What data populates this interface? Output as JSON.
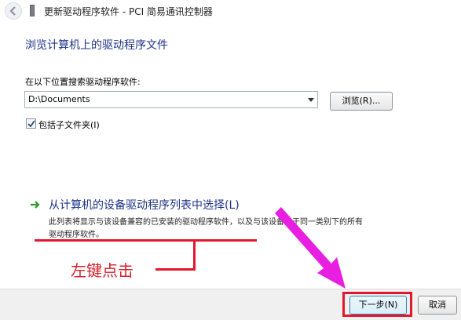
{
  "window": {
    "title": "更新驱动程序软件 - PCI 简易通讯控制器"
  },
  "page": {
    "heading": "浏览计算机上的驱动程序文件",
    "search_label": "在以下位置搜索驱动程序软件:",
    "path_value": "D:\\Documents",
    "browse_label": "浏览(R)...",
    "include_subfolders_label": "包括子文件夹(I)",
    "include_subfolders_checked": true
  },
  "pick_option": {
    "title": "从计算机的设备驱动程序列表中选择(L)",
    "description_line1": "此列表将显示与该设备兼容的已安装的驱动程序软件，以及与该设备处于同一类别下的所有",
    "description_line2": "驱动程序软件。"
  },
  "annotation": {
    "text": "左键点击",
    "color": "#d4202c",
    "arrow_color": "#e81fe0"
  },
  "footer": {
    "next_label": "下一步(N)",
    "cancel_label": "取消"
  },
  "icons": {
    "back": "back-arrow-icon",
    "title": "device-icon",
    "pick": "green-arrow-icon"
  }
}
